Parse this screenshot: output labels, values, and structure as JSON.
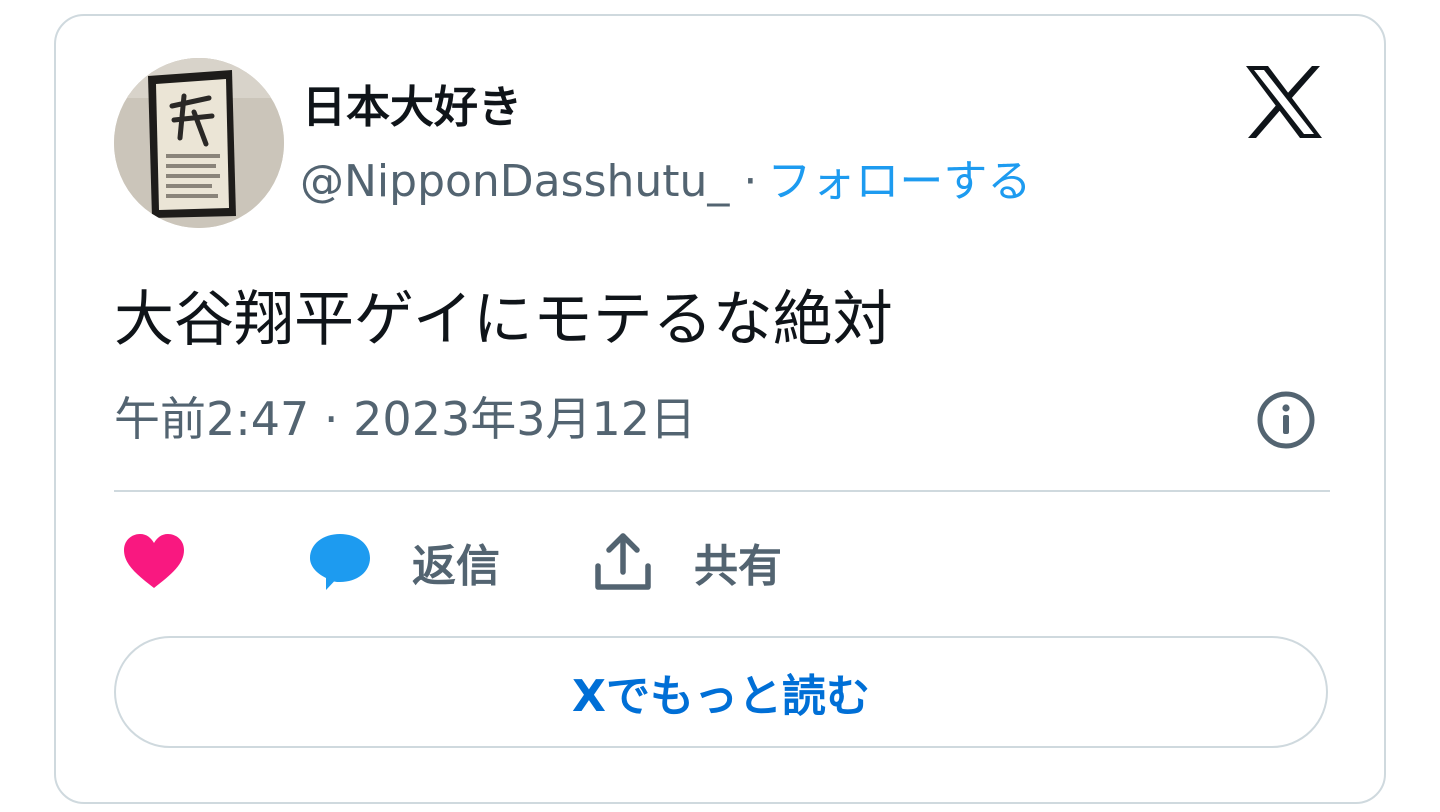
{
  "author": {
    "display_name": "日本大好き",
    "handle": "@NipponDasshutu_",
    "separator": "·",
    "follow_label": "フォローする",
    "avatar_icon": "avatar-framed-calligraphy"
  },
  "tweet": {
    "text": "大谷翔平ゲイにモテるな絶対",
    "timestamp": "午前2:47 · 2023年3月12日"
  },
  "actions": {
    "like_icon": "heart-icon",
    "reply_icon": "speech-bubble-icon",
    "reply_label": "返信",
    "share_icon": "share-upload-icon",
    "share_label": "共有"
  },
  "read_more_label": "Xでもっと読む",
  "colors": {
    "like": "#f91880",
    "reply": "#1d9bf0",
    "link": "#1d9bf0",
    "read_more": "#006fd6",
    "secondary_text": "#536471",
    "border": "#cfd9de"
  },
  "icons": {
    "brand": "x-logo-icon",
    "info": "info-icon"
  }
}
